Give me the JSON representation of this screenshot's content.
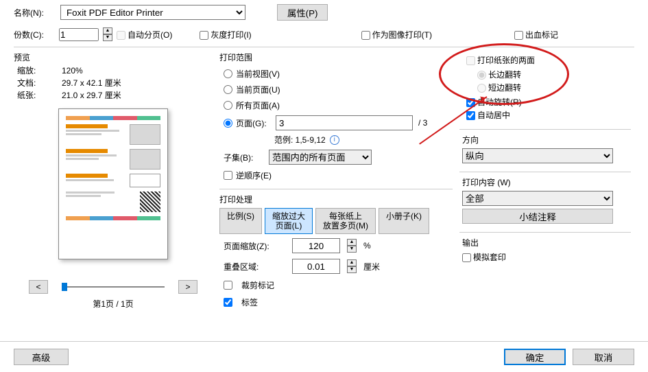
{
  "printer": {
    "name_label": "名称(N):",
    "name_value": "Foxit PDF Editor Printer",
    "properties_btn": "属性(P)",
    "copies_label": "份数(C):",
    "copies_value": "1",
    "collate_label": "自动分页(O)",
    "grayscale_label": "灰度打印(I)",
    "as_image_label": "作为图像打印(T)",
    "bleed_label": "出血标记"
  },
  "preview": {
    "title": "预览",
    "zoom_label": "缩放:",
    "zoom_value": "120%",
    "doc_label": "文档:",
    "doc_value": "29.7 x 42.1 厘米",
    "paper_label": "纸张:",
    "paper_value": "21.0 x 29.7 厘米",
    "prev_btn": "<",
    "next_btn": ">",
    "page_info": "第1页 / 1页"
  },
  "range": {
    "title": "打印范围",
    "current_view": "当前视图(V)",
    "current_page": "当前页面(U)",
    "all_pages": "所有页面(A)",
    "pages_label": "页面(G):",
    "pages_value": "3",
    "total_suffix": "/ 3",
    "example_label": "范例: 1,5-9,12",
    "subset_label": "子集(B):",
    "subset_value": "范围内的所有页面",
    "reverse_label": "逆顺序(E)"
  },
  "handling": {
    "title": "打印处理",
    "tab_scale": "比例(S)",
    "tab_fit": "缩放过大\n页面(L)",
    "tab_multi": "每张纸上\n放置多页(M)",
    "tab_booklet": "小册子(K)",
    "page_zoom_label": "页面缩放(Z):",
    "page_zoom_value": "120",
    "page_zoom_unit": "%",
    "overlap_label": "重叠区域:",
    "overlap_value": "0.01",
    "overlap_unit": "厘米",
    "crop_marks": "裁剪标记",
    "labels": "标签"
  },
  "duplex": {
    "both_sides": "打印纸张的两面",
    "long_edge": "长边翻转",
    "short_edge": "短边翻转",
    "auto_rotate": "自动旋转(R)",
    "auto_center": "自动居中"
  },
  "orientation": {
    "title": "方向",
    "value": "纵向"
  },
  "content": {
    "title": "打印内容 (W)",
    "value": "全部",
    "summary_btn": "小结注释"
  },
  "output": {
    "title": "输出",
    "overprint": "模拟套印"
  },
  "footer": {
    "advanced": "高级",
    "ok": "确定",
    "cancel": "取消"
  }
}
